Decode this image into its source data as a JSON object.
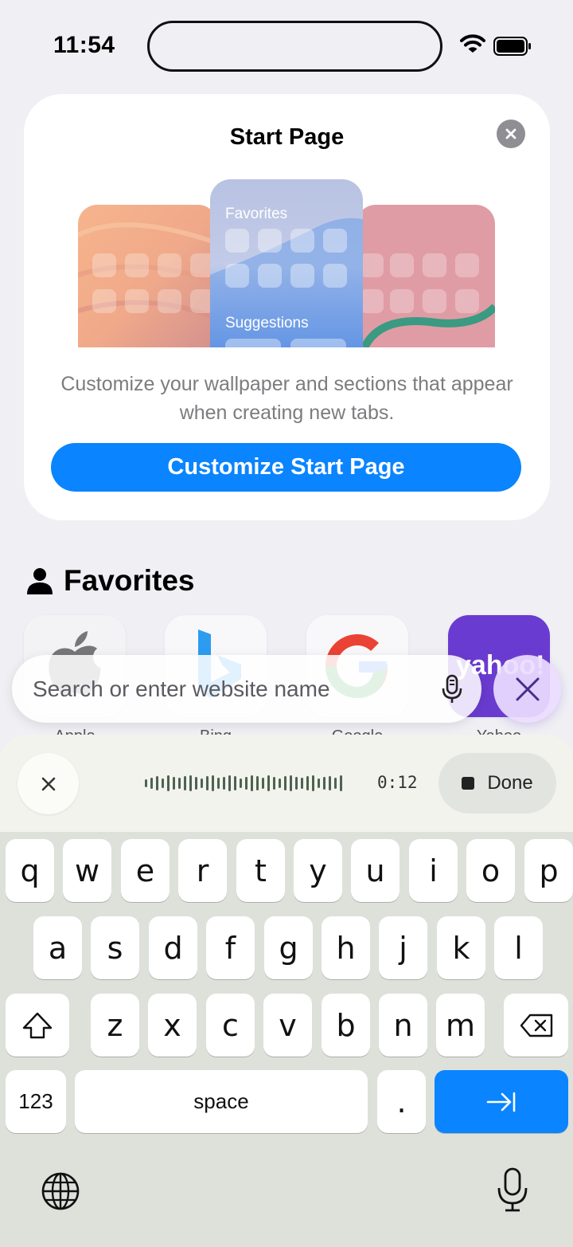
{
  "status": {
    "time": "11:54"
  },
  "card": {
    "title": "Start Page",
    "illus_favorites": "Favorites",
    "illus_suggestions": "Suggestions",
    "description": "Customize your wallpaper and sections that appear when creating new tabs.",
    "button": "Customize Start Page"
  },
  "favorites": {
    "title": "Favorites",
    "tiles": [
      {
        "label": "Apple"
      },
      {
        "label": "Bing"
      },
      {
        "label": "Google"
      },
      {
        "label": "Yahoo"
      }
    ]
  },
  "search": {
    "placeholder": "Search or enter website name"
  },
  "dictation": {
    "timer": "0:12",
    "done_label": "Done"
  },
  "keyboard": {
    "row1": [
      "q",
      "w",
      "e",
      "r",
      "t",
      "y",
      "u",
      "i",
      "o",
      "p"
    ],
    "row2": [
      "a",
      "s",
      "d",
      "f",
      "g",
      "h",
      "j",
      "k",
      "l"
    ],
    "row3": [
      "z",
      "x",
      "c",
      "v",
      "b",
      "n",
      "m"
    ],
    "numbers_label": "123",
    "space_label": "space",
    "period_label": "."
  },
  "colors": {
    "accent": "#0a84ff",
    "keyboard_bg": "#dde1da"
  }
}
